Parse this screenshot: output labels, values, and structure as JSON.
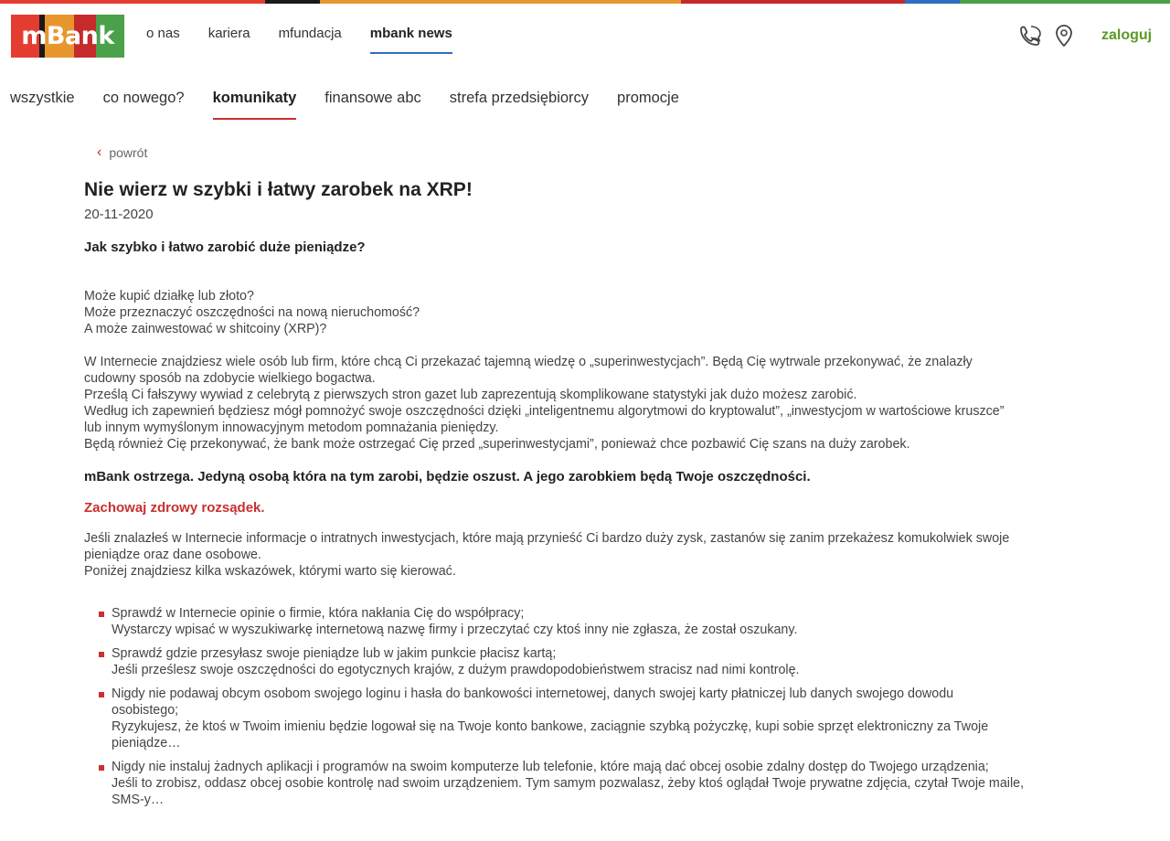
{
  "brand": {
    "logo_text": "mBank",
    "colors": [
      "#e53c32",
      "#1a1a1a",
      "#e8962e",
      "#c62a2a",
      "#4ba04a",
      "#2f6fbf"
    ]
  },
  "topnav": {
    "items": [
      {
        "label": "o nas"
      },
      {
        "label": "kariera"
      },
      {
        "label": "mfundacja"
      },
      {
        "label": "mbank news"
      }
    ]
  },
  "header": {
    "login_label": "zaloguj",
    "phone_icon": "phone-icon",
    "location_icon": "location-pin-icon"
  },
  "catnav": {
    "items": [
      {
        "label": "wszystkie"
      },
      {
        "label": "co nowego?"
      },
      {
        "label": "komunikaty"
      },
      {
        "label": "finansowe abc"
      },
      {
        "label": "strefa przedsiębiorcy"
      },
      {
        "label": "promocje"
      }
    ]
  },
  "article": {
    "back_label": "powrót",
    "title": "Nie wierz w szybki i łatwy zarobek na XRP!",
    "date": "20-11-2020",
    "subtitle": "Jak szybko i łatwo zarobić duże pieniądze?",
    "questions": [
      "Może kupić działkę lub złoto?",
      "Może przeznaczyć oszczędności na nową nieruchomość?",
      "A może zainwestować w shitcoiny (XRP)?"
    ],
    "paragraph1": [
      "W Internecie znajdziesz wiele osób lub firm, które chcą Ci przekazać tajemną wiedzę o „superinwestycjach”. Będą Cię wytrwale przekonywać, że znalazły",
      "cudowny sposób na zdobycie wielkiego bogactwa.",
      "Prześlą Ci fałszywy wywiad z celebrytą z pierwszych stron gazet lub zaprezentują skomplikowane statystyki jak dużo możesz zarobić.",
      "Według ich zapewnień będziesz mógł pomnożyć swoje oszczędności dzięki „inteligentnemu algorytmowi do kryptowalut”, „inwestycjom w wartościowe kruszce”",
      "lub innym wymyślonym innowacyjnym metodom pomnażania pieniędzy.",
      "Będą również Cię przekonywać, że bank może ostrzegać Cię przed „superinwestycjami”, ponieważ chce pozbawić Cię szans na duży zarobek."
    ],
    "warning": "mBank ostrzega. Jedyną osobą która na tym zarobi, będzie oszust. A jego zarobkiem będą Twoje oszczędności.",
    "red_heading": "Zachowaj zdrowy rozsądek.",
    "paragraph2": [
      "Jeśli znalazłeś w Internecie informacje o intratnych inwestycjach, które mają przynieść Ci bardzo duży zysk, zastanów się zanim przekażesz komukolwiek swoje",
      "pieniądze oraz dane osobowe.",
      "Poniżej znajdziesz kilka wskazówek, którymi warto się kierować."
    ],
    "tips": [
      {
        "lines": [
          "Sprawdź w Internecie opinie o firmie, która nakłania Cię do współpracy;",
          "Wystarczy wpisać w wyszukiwarkę internetową nazwę firmy i przeczytać czy ktoś inny nie zgłasza, że został oszukany."
        ]
      },
      {
        "lines": [
          "Sprawdź gdzie przesyłasz swoje pieniądze lub w jakim punkcie płacisz kartą;",
          "Jeśli prześlesz swoje oszczędności do egotycznych krajów, z dużym prawdopodobieństwem stracisz nad nimi kontrolę."
        ]
      },
      {
        "lines": [
          "Nigdy nie podawaj obcym osobom swojego loginu i hasła do bankowości internetowej, danych swojej karty płatniczej lub danych swojego dowodu",
          "osobistego;",
          "Ryzykujesz, że ktoś w Twoim imieniu będzie logował się na Twoje konto bankowe, zaciągnie szybką pożyczkę, kupi sobie sprzęt elektroniczny za Twoje",
          "pieniądze…"
        ]
      },
      {
        "lines": [
          "Nigdy nie instaluj żadnych aplikacji i programów na swoim komputerze lub telefonie, które mają dać obcej osobie zdalny dostęp do Twojego urządzenia;",
          "Jeśli to zrobisz, oddasz obcej osobie kontrolę nad swoim urządzeniem. Tym samym pozwalasz, żeby ktoś oglądał Twoje prywatne zdjęcia, czytał Twoje maile,",
          "SMS-y…"
        ]
      }
    ]
  }
}
